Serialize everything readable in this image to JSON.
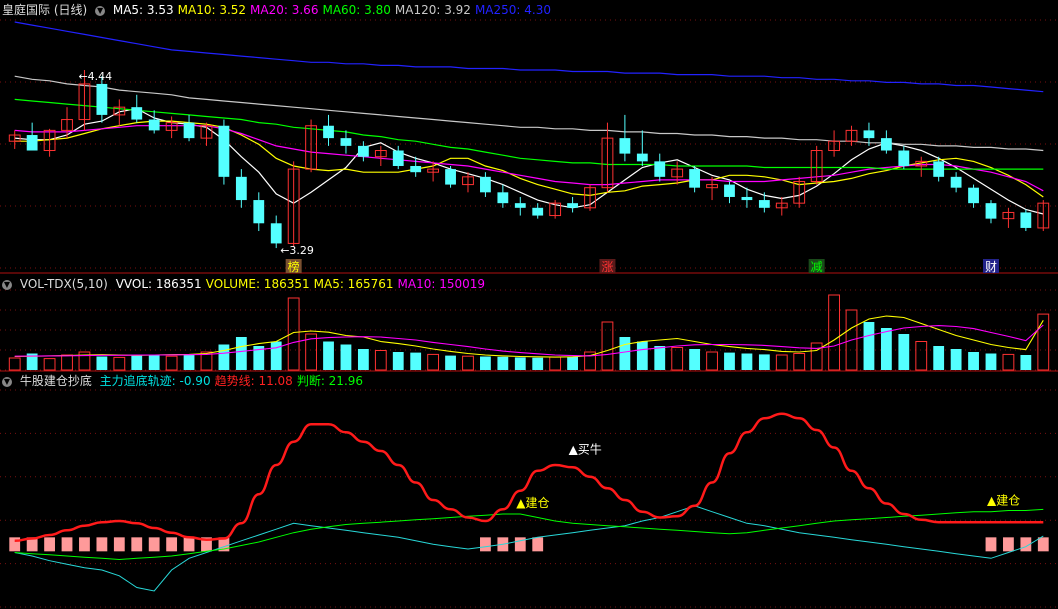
{
  "main": {
    "title": "皇庭国际 (日线)",
    "ma": [
      {
        "label": "MA5:",
        "value": "3.53",
        "color": "#ffffff"
      },
      {
        "label": "MA10:",
        "value": "3.52",
        "color": "#ffff00"
      },
      {
        "label": "MA20:",
        "value": "3.66",
        "color": "#ff00ff"
      },
      {
        "label": "MA60:",
        "value": "3.80",
        "color": "#00ff00"
      },
      {
        "label": "MA120:",
        "value": "3.92",
        "color": "#c8c8c8"
      },
      {
        "label": "MA250:",
        "value": "4.30",
        "color": "#2222ff"
      }
    ],
    "high_label": "4.44",
    "low_label": "3.29",
    "markers": [
      {
        "text": "榜",
        "color": "#ffff00",
        "bg": "#7a5030"
      },
      {
        "text": "涨",
        "color": "#ff3333",
        "bg": "#5a1a1a"
      },
      {
        "text": "减",
        "color": "#00ff00",
        "bg": "#1a4a1a"
      },
      {
        "text": "财",
        "color": "#ffffff",
        "bg": "#23238a"
      }
    ]
  },
  "volume": {
    "title": "VOL-TDX(5,10)",
    "items": [
      {
        "label": "VVOL:",
        "value": "186351",
        "color": "#ffffff"
      },
      {
        "label": "VOLUME:",
        "value": "186351",
        "color": "#ffff00"
      },
      {
        "label": "MA5:",
        "value": "165761",
        "color": "#ffff00"
      },
      {
        "label": "MA10:",
        "value": "150019",
        "color": "#ff00ff"
      }
    ]
  },
  "indicator": {
    "title": "牛股建仓抄底",
    "items": [
      {
        "label": "主力追底轨迹:",
        "value": "-0.90",
        "color": "#00e0e0"
      },
      {
        "label": "趋势线:",
        "value": "11.08",
        "color": "#ff2020"
      },
      {
        "label": "判断:",
        "value": "21.96",
        "color": "#00ff00"
      }
    ],
    "signals": [
      {
        "text": "▲建仓",
        "color": "#ffff00"
      },
      {
        "text": "▲买牛",
        "color": "#ffffff"
      },
      {
        "text": "▲建仓",
        "color": "#ffff00"
      }
    ]
  },
  "chart_data": {
    "type": "candlestick",
    "price_ylim": [
      3.2,
      4.75
    ],
    "candles": [
      [
        3.98,
        4.05,
        3.93,
        4.02
      ],
      [
        4.02,
        4.1,
        3.95,
        3.92
      ],
      [
        3.92,
        4.06,
        3.88,
        4.05
      ],
      [
        4.05,
        4.2,
        4.0,
        4.12
      ],
      [
        4.12,
        4.44,
        4.05,
        4.35
      ],
      [
        4.35,
        4.4,
        4.1,
        4.15
      ],
      [
        4.15,
        4.25,
        4.08,
        4.2
      ],
      [
        4.2,
        4.28,
        4.1,
        4.12
      ],
      [
        4.12,
        4.18,
        4.03,
        4.05
      ],
      [
        4.05,
        4.14,
        4.0,
        4.1
      ],
      [
        4.1,
        4.15,
        3.98,
        4.0
      ],
      [
        4.0,
        4.1,
        3.95,
        4.08
      ],
      [
        4.08,
        4.12,
        3.7,
        3.75
      ],
      [
        3.75,
        3.8,
        3.55,
        3.6
      ],
      [
        3.6,
        3.65,
        3.4,
        3.45
      ],
      [
        3.45,
        3.5,
        3.29,
        3.32
      ],
      [
        3.32,
        3.85,
        3.3,
        3.8
      ],
      [
        3.8,
        4.12,
        3.78,
        4.08
      ],
      [
        4.08,
        4.15,
        3.95,
        4.0
      ],
      [
        4.0,
        4.05,
        3.9,
        3.95
      ],
      [
        3.95,
        3.98,
        3.85,
        3.88
      ],
      [
        3.88,
        3.95,
        3.82,
        3.92
      ],
      [
        3.92,
        3.95,
        3.8,
        3.82
      ],
      [
        3.82,
        3.88,
        3.75,
        3.78
      ],
      [
        3.78,
        3.85,
        3.72,
        3.8
      ],
      [
        3.8,
        3.82,
        3.68,
        3.7
      ],
      [
        3.7,
        3.78,
        3.65,
        3.75
      ],
      [
        3.75,
        3.78,
        3.62,
        3.65
      ],
      [
        3.65,
        3.7,
        3.55,
        3.58
      ],
      [
        3.58,
        3.62,
        3.5,
        3.55
      ],
      [
        3.55,
        3.58,
        3.48,
        3.5
      ],
      [
        3.5,
        3.6,
        3.48,
        3.58
      ],
      [
        3.58,
        3.62,
        3.52,
        3.55
      ],
      [
        3.55,
        3.7,
        3.53,
        3.68
      ],
      [
        3.68,
        4.1,
        3.65,
        4.0
      ],
      [
        4.0,
        4.15,
        3.85,
        3.9
      ],
      [
        3.9,
        4.05,
        3.82,
        3.85
      ],
      [
        3.85,
        3.9,
        3.72,
        3.75
      ],
      [
        3.75,
        3.85,
        3.7,
        3.8
      ],
      [
        3.8,
        3.82,
        3.65,
        3.68
      ],
      [
        3.68,
        3.75,
        3.6,
        3.7
      ],
      [
        3.7,
        3.72,
        3.58,
        3.62
      ],
      [
        3.62,
        3.68,
        3.55,
        3.6
      ],
      [
        3.6,
        3.65,
        3.52,
        3.55
      ],
      [
        3.55,
        3.62,
        3.5,
        3.58
      ],
      [
        3.58,
        3.75,
        3.55,
        3.72
      ],
      [
        3.72,
        3.95,
        3.7,
        3.92
      ],
      [
        3.92,
        4.05,
        3.88,
        3.98
      ],
      [
        3.98,
        4.08,
        3.95,
        4.05
      ],
      [
        4.05,
        4.1,
        3.95,
        4.0
      ],
      [
        4.0,
        4.05,
        3.9,
        3.92
      ],
      [
        3.92,
        3.95,
        3.8,
        3.82
      ],
      [
        3.82,
        3.88,
        3.75,
        3.85
      ],
      [
        3.85,
        3.88,
        3.72,
        3.75
      ],
      [
        3.75,
        3.78,
        3.65,
        3.68
      ],
      [
        3.68,
        3.7,
        3.55,
        3.58
      ],
      [
        3.58,
        3.6,
        3.45,
        3.48
      ],
      [
        3.48,
        3.55,
        3.42,
        3.52
      ],
      [
        3.52,
        3.54,
        3.4,
        3.42
      ],
      [
        3.42,
        3.6,
        3.4,
        3.58
      ]
    ],
    "ma_series": {
      "MA5": [
        4.0,
        3.99,
        3.99,
        4.02,
        4.09,
        4.11,
        4.17,
        4.19,
        4.13,
        4.1,
        4.09,
        4.07,
        3.99,
        3.88,
        3.78,
        3.64,
        3.58,
        3.65,
        3.73,
        3.81,
        3.94,
        3.97,
        3.91,
        3.87,
        3.84,
        3.8,
        3.77,
        3.74,
        3.7,
        3.65,
        3.6,
        3.57,
        3.55,
        3.57,
        3.65,
        3.73,
        3.81,
        3.84,
        3.86,
        3.81,
        3.76,
        3.73,
        3.67,
        3.63,
        3.61,
        3.63,
        3.69,
        3.77,
        3.86,
        3.93,
        3.97,
        3.95,
        3.92,
        3.87,
        3.81,
        3.74,
        3.67,
        3.6,
        3.54,
        3.51
      ],
      "MA10": [
        3.98,
        3.98,
        3.99,
        4.0,
        4.03,
        4.06,
        4.08,
        4.1,
        4.11,
        4.11,
        4.1,
        4.09,
        4.07,
        4.02,
        3.96,
        3.87,
        3.82,
        3.8,
        3.79,
        3.8,
        3.78,
        3.78,
        3.78,
        3.8,
        3.82,
        3.87,
        3.87,
        3.82,
        3.79,
        3.74,
        3.7,
        3.67,
        3.64,
        3.63,
        3.65,
        3.66,
        3.69,
        3.7,
        3.71,
        3.73,
        3.73,
        3.76,
        3.76,
        3.75,
        3.73,
        3.7,
        3.71,
        3.72,
        3.74,
        3.77,
        3.79,
        3.82,
        3.84,
        3.86,
        3.87,
        3.85,
        3.81,
        3.76,
        3.7,
        3.62
      ],
      "MA20": [
        4.05,
        4.04,
        4.04,
        4.04,
        4.05,
        4.06,
        4.07,
        4.08,
        4.08,
        4.08,
        4.08,
        4.08,
        4.06,
        4.03,
        3.99,
        3.95,
        3.93,
        3.91,
        3.9,
        3.89,
        3.88,
        3.87,
        3.86,
        3.85,
        3.84,
        3.83,
        3.82,
        3.8,
        3.78,
        3.76,
        3.74,
        3.72,
        3.71,
        3.7,
        3.7,
        3.71,
        3.72,
        3.73,
        3.73,
        3.73,
        3.73,
        3.72,
        3.72,
        3.72,
        3.73,
        3.74,
        3.75,
        3.76,
        3.78,
        3.8,
        3.81,
        3.82,
        3.83,
        3.83,
        3.82,
        3.8,
        3.78,
        3.75,
        3.72,
        3.66
      ],
      "MA60": [
        4.25,
        4.24,
        4.23,
        4.22,
        4.21,
        4.2,
        4.19,
        4.18,
        4.17,
        4.16,
        4.15,
        4.14,
        4.13,
        4.12,
        4.1,
        4.09,
        4.07,
        4.06,
        4.05,
        4.04,
        4.02,
        4.01,
        3.99,
        3.98,
        3.96,
        3.94,
        3.93,
        3.91,
        3.89,
        3.87,
        3.86,
        3.85,
        3.84,
        3.84,
        3.83,
        3.83,
        3.83,
        3.83,
        3.82,
        3.82,
        3.82,
        3.82,
        3.82,
        3.81,
        3.81,
        3.81,
        3.81,
        3.81,
        3.81,
        3.81,
        3.8,
        3.8,
        3.8,
        3.8,
        3.8,
        3.8,
        3.8,
        3.8,
        3.8,
        3.8
      ],
      "MA120": [
        4.4,
        4.38,
        4.37,
        4.35,
        4.34,
        4.33,
        4.31,
        4.3,
        4.29,
        4.28,
        4.26,
        4.25,
        4.24,
        4.23,
        4.22,
        4.21,
        4.2,
        4.19,
        4.18,
        4.17,
        4.16,
        4.15,
        4.14,
        4.13,
        4.12,
        4.11,
        4.1,
        4.09,
        4.08,
        4.07,
        4.07,
        4.06,
        4.06,
        4.05,
        4.05,
        4.04,
        4.04,
        4.03,
        4.03,
        4.02,
        4.02,
        4.01,
        4.01,
        4.0,
        4.0,
        3.99,
        3.99,
        3.98,
        3.98,
        3.97,
        3.97,
        3.96,
        3.96,
        3.95,
        3.95,
        3.94,
        3.94,
        3.93,
        3.93,
        3.92
      ],
      "MA250": [
        4.75,
        4.73,
        4.71,
        4.69,
        4.67,
        4.65,
        4.63,
        4.61,
        4.59,
        4.57,
        4.56,
        4.55,
        4.54,
        4.53,
        4.52,
        4.51,
        4.5,
        4.49,
        4.49,
        4.48,
        4.48,
        4.47,
        4.47,
        4.46,
        4.46,
        4.46,
        4.45,
        4.45,
        4.45,
        4.44,
        4.44,
        4.44,
        4.43,
        4.43,
        4.43,
        4.42,
        4.42,
        4.42,
        4.41,
        4.41,
        4.41,
        4.4,
        4.4,
        4.4,
        4.39,
        4.39,
        4.38,
        4.38,
        4.37,
        4.37,
        4.36,
        4.36,
        4.35,
        4.35,
        4.34,
        4.34,
        4.33,
        4.32,
        4.31,
        4.3
      ]
    },
    "volume_ymax": 260000,
    "volume": [
      40000,
      55000,
      38000,
      50000,
      60000,
      45000,
      42000,
      48000,
      50000,
      46000,
      52000,
      60000,
      85000,
      110000,
      80000,
      95000,
      240000,
      120000,
      95000,
      85000,
      70000,
      65000,
      60000,
      58000,
      52000,
      48000,
      46000,
      45000,
      44000,
      42000,
      41000,
      43000,
      44000,
      60000,
      160000,
      110000,
      95000,
      80000,
      75000,
      70000,
      60000,
      58000,
      55000,
      52000,
      50000,
      55000,
      90000,
      250000,
      200000,
      160000,
      140000,
      120000,
      95000,
      80000,
      70000,
      60000,
      55000,
      52000,
      50000,
      186351
    ],
    "volume_ma5": [
      45000,
      46000,
      47000,
      48000,
      50000,
      51000,
      50000,
      49000,
      50000,
      51000,
      52000,
      55000,
      65000,
      78000,
      88000,
      95000,
      125000,
      130000,
      126000,
      115000,
      110000,
      95000,
      88000,
      80000,
      70000,
      62000,
      55000,
      50000,
      47000,
      45000,
      44000,
      43000,
      44000,
      48000,
      65000,
      85000,
      95000,
      100000,
      105000,
      95000,
      85000,
      78000,
      72000,
      68000,
      62000,
      60000,
      65000,
      100000,
      140000,
      170000,
      180000,
      175000,
      155000,
      135000,
      115000,
      100000,
      85000,
      75000,
      68000,
      165761
    ],
    "volume_ma10": [
      46000,
      46500,
      47000,
      47500,
      48000,
      49000,
      49000,
      49500,
      50000,
      50500,
      51000,
      52000,
      56000,
      62000,
      68000,
      74000,
      92000,
      104000,
      108000,
      110000,
      111000,
      110000,
      105000,
      100000,
      92000,
      85000,
      78000,
      70000,
      63000,
      58000,
      54000,
      50000,
      48000,
      47000,
      52000,
      60000,
      68000,
      74000,
      80000,
      84000,
      85000,
      85000,
      84000,
      82000,
      78000,
      74000,
      72000,
      80000,
      100000,
      115000,
      128000,
      140000,
      145000,
      148000,
      145000,
      138000,
      125000,
      112000,
      98000,
      150019
    ],
    "indicator_ylim": [
      -60,
      120
    ],
    "trend_line": [
      -5,
      -3,
      0,
      4,
      8,
      11,
      12,
      10,
      6,
      2,
      -2,
      -4,
      -3,
      10,
      35,
      60,
      80,
      95,
      95,
      88,
      80,
      72,
      60,
      45,
      30,
      22,
      15,
      12,
      22,
      38,
      55,
      60,
      58,
      50,
      40,
      30,
      20,
      15,
      16,
      25,
      45,
      70,
      88,
      100,
      104,
      100,
      90,
      75,
      55,
      40,
      27,
      18,
      13,
      11,
      11,
      11,
      11,
      11,
      11,
      11
    ],
    "judge_line": [
      -15,
      -16,
      -17,
      -18,
      -19,
      -20,
      -21,
      -20,
      -19,
      -18,
      -16,
      -14,
      -12,
      -9,
      -6,
      -2,
      2,
      5,
      7,
      9,
      10,
      11,
      12,
      13,
      14,
      15,
      16,
      17,
      18,
      18,
      15,
      12,
      10,
      9,
      8,
      7,
      6,
      5,
      4,
      3,
      2,
      1,
      2,
      4,
      6,
      8,
      10,
      12,
      13,
      14,
      15,
      16,
      17,
      18,
      19,
      20,
      20,
      21,
      21,
      21.96
    ],
    "bottom_track": [
      -15,
      -18,
      -22,
      -25,
      -28,
      -30,
      -35,
      -45,
      -48,
      -30,
      -20,
      -15,
      -10,
      -5,
      0,
      5,
      10,
      8,
      6,
      4,
      2,
      0,
      -2,
      -5,
      -8,
      -10,
      -12,
      -10,
      -8,
      -5,
      -2,
      0,
      2,
      4,
      6,
      8,
      12,
      15,
      20,
      25,
      20,
      15,
      10,
      8,
      5,
      2,
      0,
      -2,
      -4,
      -6,
      -8,
      -10,
      -12,
      -14,
      -16,
      -18,
      -20,
      -15,
      -10,
      -0.9
    ],
    "buy_zones": [
      [
        0,
        12
      ],
      [
        27,
        30
      ],
      [
        56,
        59
      ]
    ],
    "signal_positions": [
      29,
      32,
      56
    ]
  }
}
